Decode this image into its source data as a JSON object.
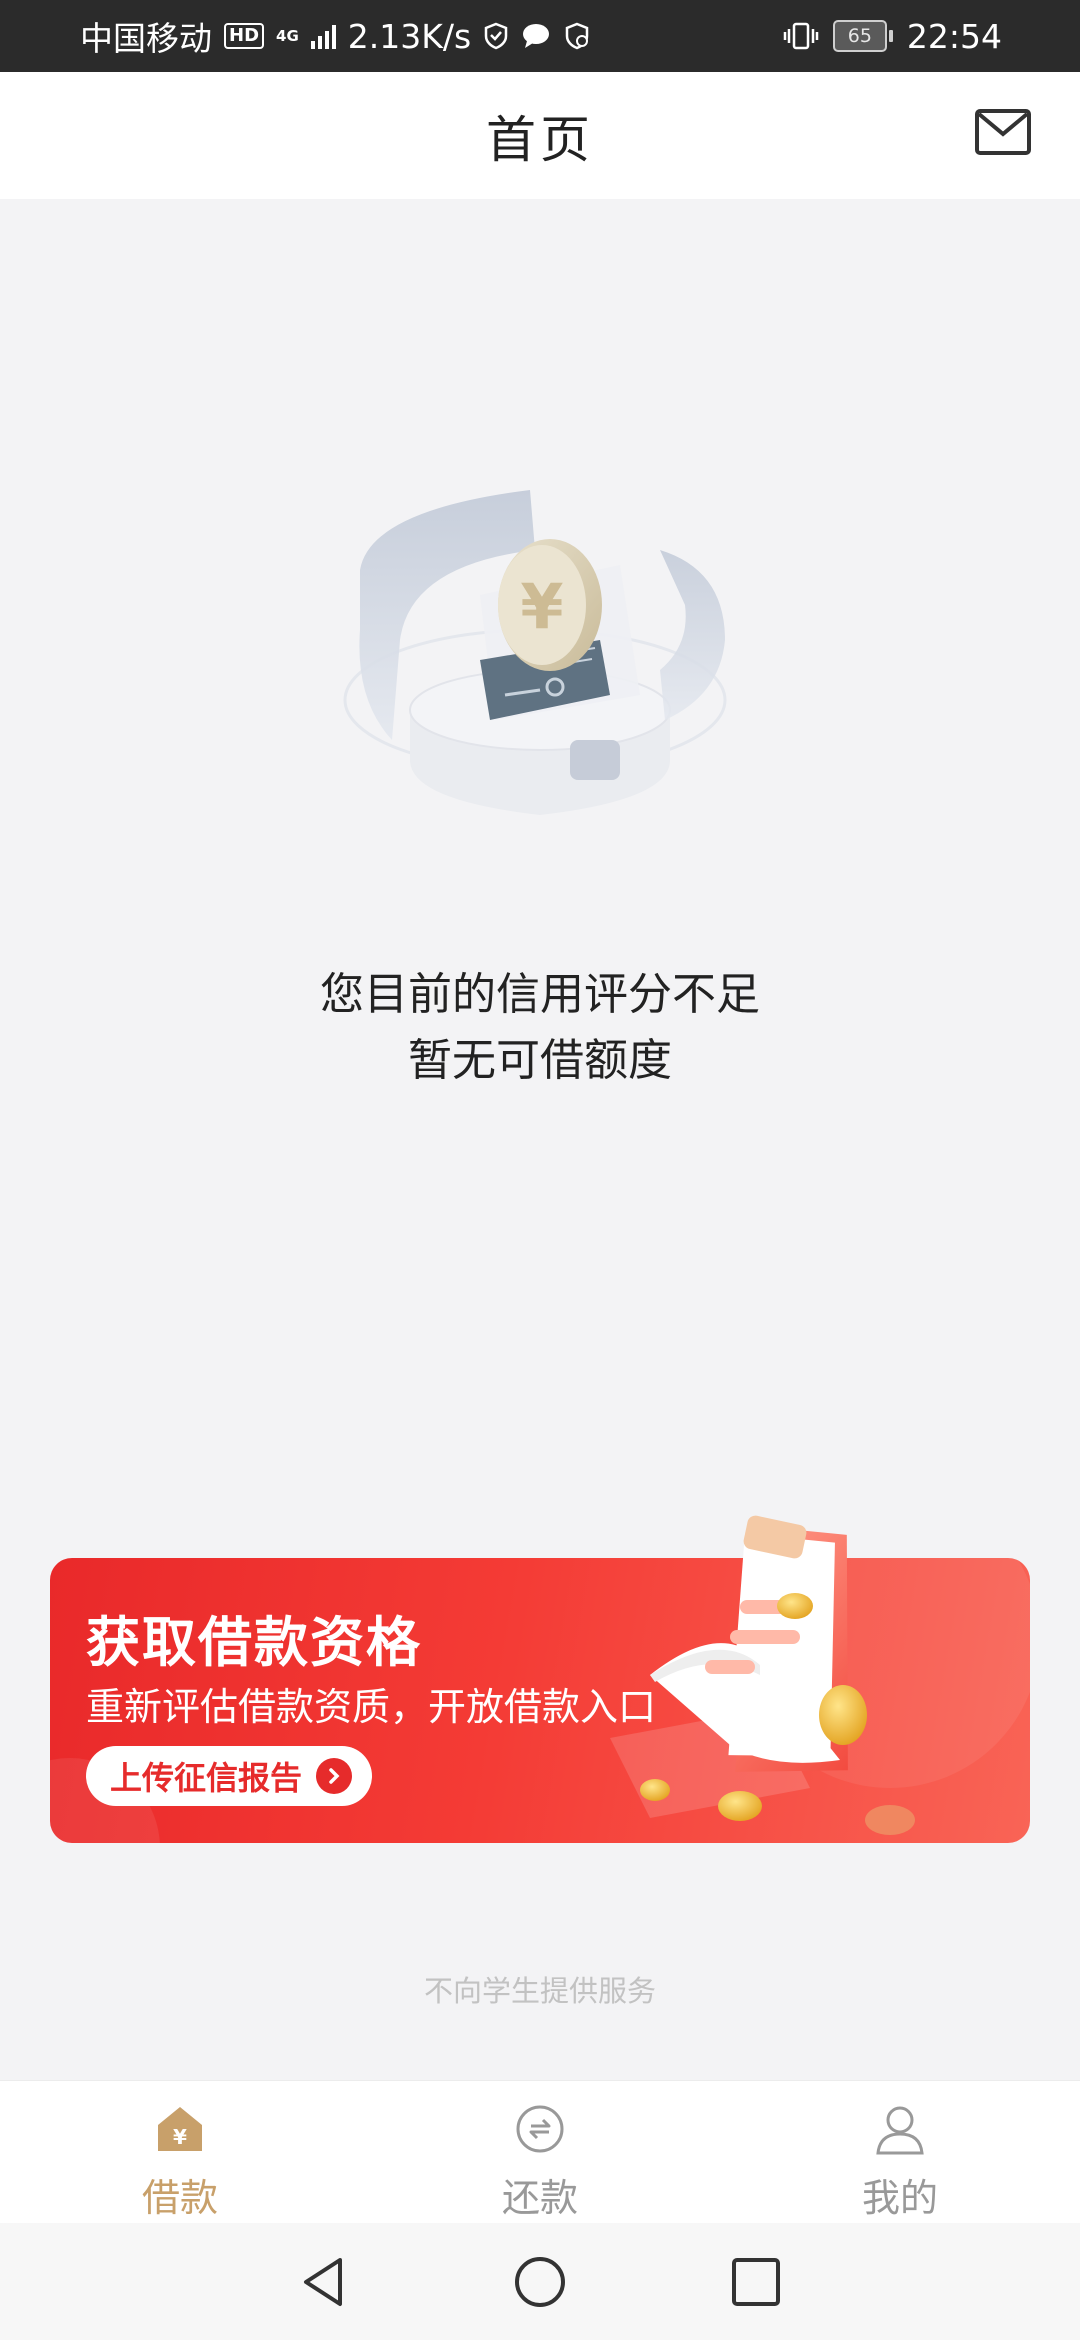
{
  "status_bar": {
    "carrier": "中国移动",
    "hd": "HD",
    "network": "4G",
    "speed": "2.13K/s",
    "battery": "65",
    "time": "22:54"
  },
  "header": {
    "title": "首页"
  },
  "empty_state": {
    "line1": "您目前的信用评分不足",
    "line2": "暂无可借额度"
  },
  "banner": {
    "title": "获取借款资格",
    "subtitle": "重新评估借款资质，开放借款入口",
    "button": "上传征信报告"
  },
  "footnote": "不向学生提供服务",
  "tabs": [
    {
      "label": "借款",
      "icon": "loan-home-icon",
      "active": true
    },
    {
      "label": "还款",
      "icon": "repay-icon",
      "active": false
    },
    {
      "label": "我的",
      "icon": "profile-icon",
      "active": false
    }
  ],
  "colors": {
    "accent_gold": "#c8a06a",
    "banner_red": "#e9292a"
  }
}
